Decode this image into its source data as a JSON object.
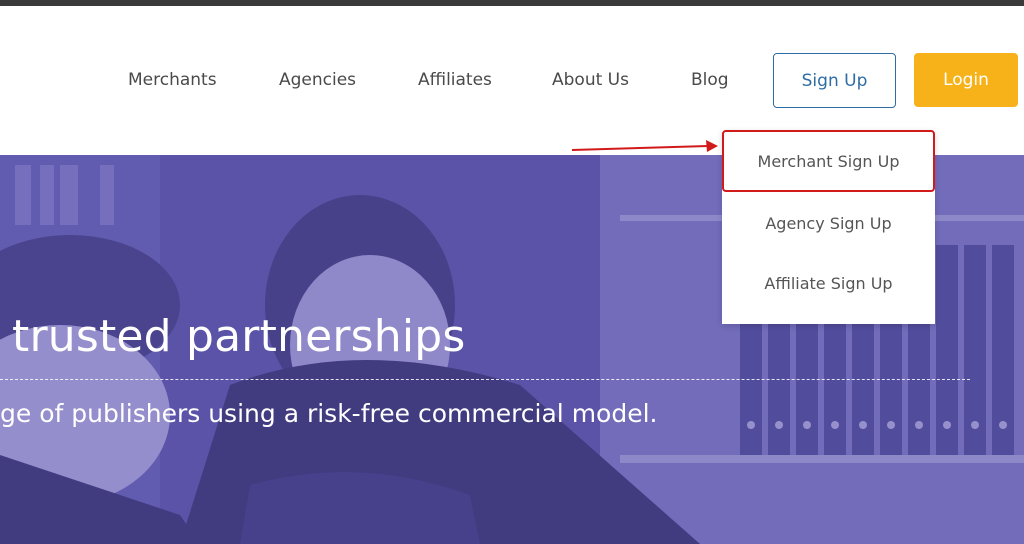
{
  "nav": {
    "items": [
      "Merchants",
      "Agencies",
      "Affiliates",
      "About Us",
      "Blog"
    ],
    "signup_label": "Sign Up",
    "login_label": "Login"
  },
  "dropdown": {
    "items": [
      "Merchant Sign Up",
      "Agency Sign Up",
      "Affiliate Sign Up"
    ],
    "highlighted_index": 0
  },
  "hero": {
    "title": "trusted partnerships",
    "subtitle": "ge of publishers using a risk-free commercial model."
  },
  "colors": {
    "accent_blue": "#2e6da4",
    "login_yellow": "#f7b21a",
    "hero_purple": "#5a55a2",
    "annotation_red": "#d11a1a"
  }
}
